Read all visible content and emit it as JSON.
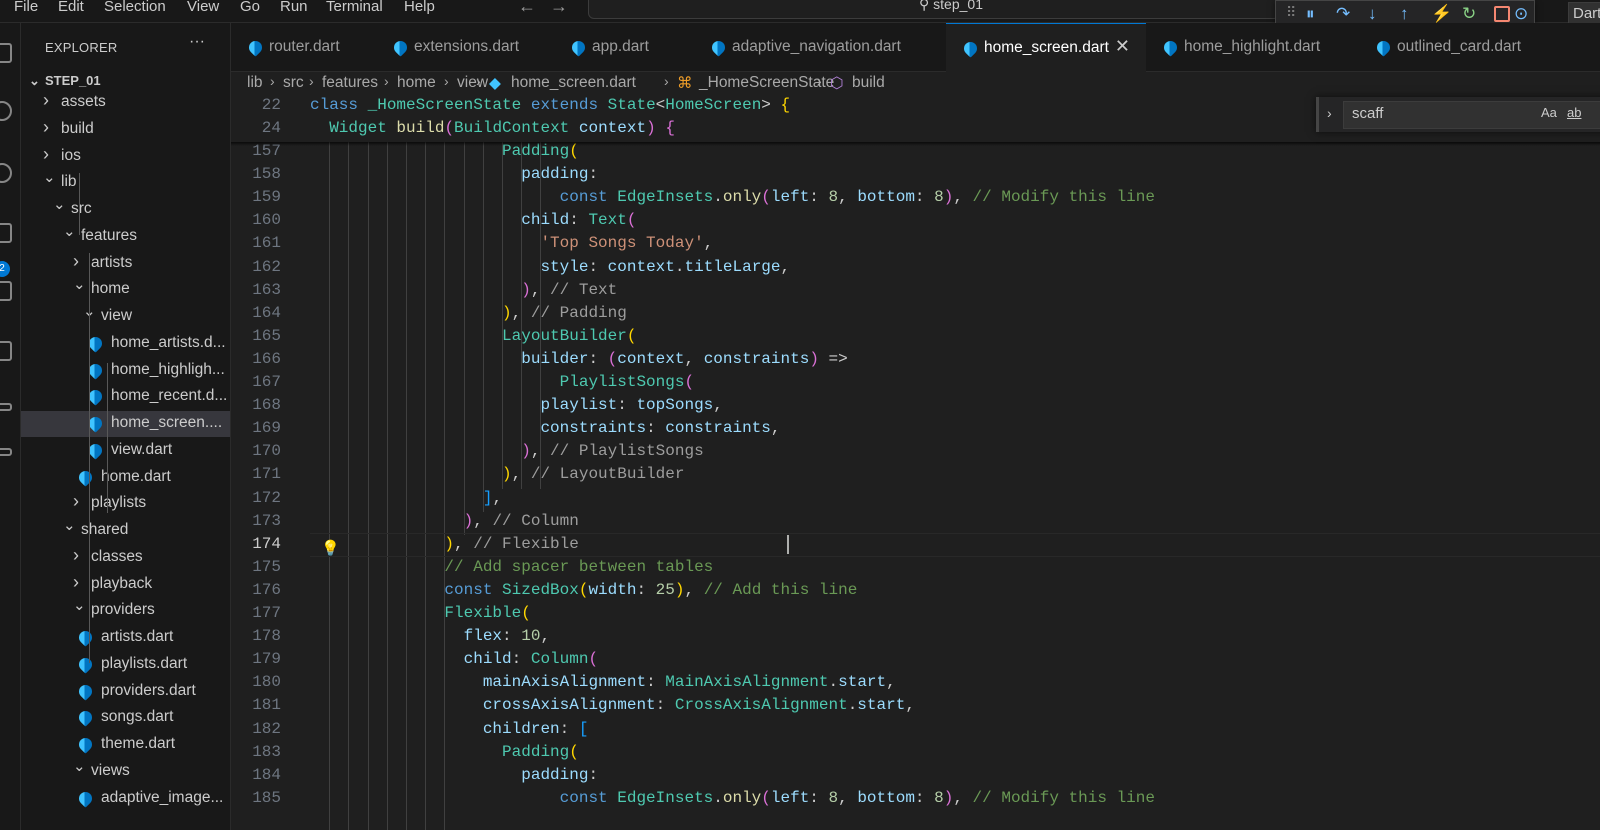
{
  "menu": [
    "File",
    "Edit",
    "Selection",
    "View",
    "Go",
    "Run",
    "Terminal",
    "Help"
  ],
  "command_center": {
    "text": "step_01"
  },
  "debug_toolbar": {
    "dart_label": "Dart"
  },
  "activity_badge": "2",
  "explorer": {
    "title": "EXPLORER",
    "more": "···",
    "root": "STEP_01",
    "items": [
      {
        "label": "assets",
        "type": "folder",
        "depth": 1,
        "open": false
      },
      {
        "label": "build",
        "type": "folder",
        "depth": 1,
        "open": false
      },
      {
        "label": "ios",
        "type": "folder",
        "depth": 1,
        "open": false
      },
      {
        "label": "lib",
        "type": "folder",
        "depth": 1,
        "open": true
      },
      {
        "label": "src",
        "type": "folder",
        "depth": 2,
        "open": true
      },
      {
        "label": "features",
        "type": "folder",
        "depth": 3,
        "open": true
      },
      {
        "label": "artists",
        "type": "folder",
        "depth": 4,
        "open": false
      },
      {
        "label": "home",
        "type": "folder",
        "depth": 4,
        "open": true
      },
      {
        "label": "view",
        "type": "folder",
        "depth": 5,
        "open": true
      },
      {
        "label": "home_artists.d...",
        "type": "file",
        "depth": 6
      },
      {
        "label": "home_highligh...",
        "type": "file",
        "depth": 6
      },
      {
        "label": "home_recent.d...",
        "type": "file",
        "depth": 6
      },
      {
        "label": "home_screen....",
        "type": "file",
        "depth": 6,
        "selected": true
      },
      {
        "label": "view.dart",
        "type": "file",
        "depth": 6
      },
      {
        "label": "home.dart",
        "type": "file",
        "depth": 5
      },
      {
        "label": "playlists",
        "type": "folder",
        "depth": 4,
        "open": false
      },
      {
        "label": "shared",
        "type": "folder",
        "depth": 3,
        "open": true
      },
      {
        "label": "classes",
        "type": "folder",
        "depth": 4,
        "open": false
      },
      {
        "label": "playback",
        "type": "folder",
        "depth": 4,
        "open": false
      },
      {
        "label": "providers",
        "type": "folder",
        "depth": 4,
        "open": true
      },
      {
        "label": "artists.dart",
        "type": "file",
        "depth": 5
      },
      {
        "label": "playlists.dart",
        "type": "file",
        "depth": 5
      },
      {
        "label": "providers.dart",
        "type": "file",
        "depth": 5
      },
      {
        "label": "songs.dart",
        "type": "file",
        "depth": 5
      },
      {
        "label": "theme.dart",
        "type": "file",
        "depth": 5
      },
      {
        "label": "views",
        "type": "folder",
        "depth": 4,
        "open": true
      },
      {
        "label": "adaptive_image...",
        "type": "file",
        "depth": 5
      }
    ]
  },
  "tabs": [
    {
      "label": "router.dart",
      "active": false
    },
    {
      "label": "extensions.dart",
      "active": false
    },
    {
      "label": "app.dart",
      "active": false
    },
    {
      "label": "adaptive_navigation.dart",
      "active": false
    },
    {
      "label": "home_screen.dart",
      "active": true
    },
    {
      "label": "home_highlight.dart",
      "active": false
    },
    {
      "label": "outlined_card.dart",
      "active": false
    }
  ],
  "breadcrumb": [
    "lib",
    "src",
    "features",
    "home",
    "view",
    "home_screen.dart",
    "_HomeScreenState",
    "build"
  ],
  "find": {
    "query": "scaff",
    "match_case": "Aa",
    "whole_word": "ab"
  },
  "editor": {
    "current_line": "174",
    "sticky_lines": [
      {
        "num": "22",
        "tokens": [
          [
            "kw",
            "class "
          ],
          [
            "ty",
            "_HomeScreenState "
          ],
          [
            "kw",
            "extends "
          ],
          [
            "ty",
            "State"
          ],
          [
            "pu",
            "<"
          ],
          [
            "ty",
            "HomeScreen"
          ],
          [
            "pu",
            "> "
          ],
          [
            "b1",
            "{"
          ]
        ]
      },
      {
        "num": "24",
        "tokens": [
          [
            "pu",
            "  "
          ],
          [
            "ty",
            "Widget "
          ],
          [
            "fn",
            "build"
          ],
          [
            "b2",
            "("
          ],
          [
            "ty",
            "BuildContext "
          ],
          [
            "prop",
            "context"
          ],
          [
            "b2",
            ")"
          ],
          [
            "pu",
            " "
          ],
          [
            "b2",
            "{"
          ]
        ]
      }
    ],
    "lines": [
      {
        "num": "157",
        "tokens": [
          [
            "pu",
            "                    "
          ],
          [
            "ty",
            "Padding"
          ],
          [
            "b1",
            "("
          ]
        ]
      },
      {
        "num": "158",
        "tokens": [
          [
            "pu",
            "                      "
          ],
          [
            "prop",
            "padding"
          ],
          [
            "pu",
            ":"
          ]
        ]
      },
      {
        "num": "159",
        "tokens": [
          [
            "pu",
            "                          "
          ],
          [
            "kw",
            "const "
          ],
          [
            "ty",
            "EdgeInsets"
          ],
          [
            "pu",
            "."
          ],
          [
            "fn",
            "only"
          ],
          [
            "b2",
            "("
          ],
          [
            "prop",
            "left"
          ],
          [
            "pu",
            ": "
          ],
          [
            "num",
            "8"
          ],
          [
            "pu",
            ", "
          ],
          [
            "prop",
            "bottom"
          ],
          [
            "pu",
            ": "
          ],
          [
            "num",
            "8"
          ],
          [
            "b2",
            ")"
          ],
          [
            "pu",
            ", "
          ],
          [
            "cm",
            "// Modify this line"
          ]
        ]
      },
      {
        "num": "160",
        "tokens": [
          [
            "pu",
            "                      "
          ],
          [
            "prop",
            "child"
          ],
          [
            "pu",
            ": "
          ],
          [
            "ty",
            "Text"
          ],
          [
            "b2",
            "("
          ]
        ]
      },
      {
        "num": "161",
        "tokens": [
          [
            "pu",
            "                        "
          ],
          [
            "str",
            "'Top Songs Today'"
          ],
          [
            "pu",
            ","
          ]
        ]
      },
      {
        "num": "162",
        "tokens": [
          [
            "pu",
            "                        "
          ],
          [
            "prop",
            "style"
          ],
          [
            "pu",
            ": "
          ],
          [
            "prop",
            "context"
          ],
          [
            "pu",
            "."
          ],
          [
            "prop",
            "titleLarge"
          ],
          [
            "pu",
            ","
          ]
        ]
      },
      {
        "num": "163",
        "tokens": [
          [
            "pu",
            "                      "
          ],
          [
            "b2",
            ")"
          ],
          [
            "pu",
            ", "
          ],
          [
            "cgray",
            "// Text"
          ]
        ]
      },
      {
        "num": "164",
        "tokens": [
          [
            "pu",
            "                    "
          ],
          [
            "b1",
            ")"
          ],
          [
            "pu",
            ", "
          ],
          [
            "cgray",
            "// Padding"
          ]
        ]
      },
      {
        "num": "165",
        "tokens": [
          [
            "pu",
            "                    "
          ],
          [
            "ty",
            "LayoutBuilder"
          ],
          [
            "b1",
            "("
          ]
        ]
      },
      {
        "num": "166",
        "tokens": [
          [
            "pu",
            "                      "
          ],
          [
            "prop",
            "builder"
          ],
          [
            "pu",
            ": "
          ],
          [
            "b2",
            "("
          ],
          [
            "prop",
            "context"
          ],
          [
            "pu",
            ", "
          ],
          [
            "prop",
            "constraints"
          ],
          [
            "b2",
            ")"
          ],
          [
            "pu",
            " =>"
          ]
        ]
      },
      {
        "num": "167",
        "tokens": [
          [
            "pu",
            "                          "
          ],
          [
            "ty",
            "PlaylistSongs"
          ],
          [
            "b2",
            "("
          ]
        ]
      },
      {
        "num": "168",
        "tokens": [
          [
            "pu",
            "                        "
          ],
          [
            "prop",
            "playlist"
          ],
          [
            "pu",
            ": "
          ],
          [
            "prop",
            "topSongs"
          ],
          [
            "pu",
            ","
          ]
        ]
      },
      {
        "num": "169",
        "tokens": [
          [
            "pu",
            "                        "
          ],
          [
            "prop",
            "constraints"
          ],
          [
            "pu",
            ": "
          ],
          [
            "prop",
            "constraints"
          ],
          [
            "pu",
            ","
          ]
        ]
      },
      {
        "num": "170",
        "tokens": [
          [
            "pu",
            "                      "
          ],
          [
            "b2",
            ")"
          ],
          [
            "pu",
            ", "
          ],
          [
            "cgray",
            "// PlaylistSongs"
          ]
        ]
      },
      {
        "num": "171",
        "tokens": [
          [
            "pu",
            "                    "
          ],
          [
            "b1",
            ")"
          ],
          [
            "pu",
            ", "
          ],
          [
            "cgray",
            "// LayoutBuilder"
          ]
        ]
      },
      {
        "num": "172",
        "tokens": [
          [
            "pu",
            "                  "
          ],
          [
            "b3",
            "]"
          ],
          [
            "pu",
            ","
          ]
        ]
      },
      {
        "num": "173",
        "tokens": [
          [
            "pu",
            "                "
          ],
          [
            "b2",
            ")"
          ],
          [
            "pu",
            ", "
          ],
          [
            "cgray",
            "// Column"
          ]
        ]
      },
      {
        "num": "174",
        "tokens": [
          [
            "pu",
            "              "
          ],
          [
            "b1",
            ")"
          ],
          [
            "pu",
            ", "
          ],
          [
            "cgray",
            "// Flexible"
          ]
        ]
      },
      {
        "num": "175",
        "tokens": [
          [
            "pu",
            "              "
          ],
          [
            "cm",
            "// Add spacer between tables"
          ]
        ]
      },
      {
        "num": "176",
        "tokens": [
          [
            "pu",
            "              "
          ],
          [
            "kw",
            "const "
          ],
          [
            "ty",
            "SizedBox"
          ],
          [
            "b1",
            "("
          ],
          [
            "prop",
            "width"
          ],
          [
            "pu",
            ": "
          ],
          [
            "num",
            "25"
          ],
          [
            "b1",
            ")"
          ],
          [
            "pu",
            ", "
          ],
          [
            "cm",
            "// Add this line"
          ]
        ]
      },
      {
        "num": "177",
        "tokens": [
          [
            "pu",
            "              "
          ],
          [
            "ty",
            "Flexible"
          ],
          [
            "b1",
            "("
          ]
        ]
      },
      {
        "num": "178",
        "tokens": [
          [
            "pu",
            "                "
          ],
          [
            "prop",
            "flex"
          ],
          [
            "pu",
            ": "
          ],
          [
            "num",
            "10"
          ],
          [
            "pu",
            ","
          ]
        ]
      },
      {
        "num": "179",
        "tokens": [
          [
            "pu",
            "                "
          ],
          [
            "prop",
            "child"
          ],
          [
            "pu",
            ": "
          ],
          [
            "ty",
            "Column"
          ],
          [
            "b2",
            "("
          ]
        ]
      },
      {
        "num": "180",
        "tokens": [
          [
            "pu",
            "                  "
          ],
          [
            "prop",
            "mainAxisAlignment"
          ],
          [
            "pu",
            ": "
          ],
          [
            "ty",
            "MainAxisAlignment"
          ],
          [
            "pu",
            "."
          ],
          [
            "prop",
            "start"
          ],
          [
            "pu",
            ","
          ]
        ]
      },
      {
        "num": "181",
        "tokens": [
          [
            "pu",
            "                  "
          ],
          [
            "prop",
            "crossAxisAlignment"
          ],
          [
            "pu",
            ": "
          ],
          [
            "ty",
            "CrossAxisAlignment"
          ],
          [
            "pu",
            "."
          ],
          [
            "prop",
            "start"
          ],
          [
            "pu",
            ","
          ]
        ]
      },
      {
        "num": "182",
        "tokens": [
          [
            "pu",
            "                  "
          ],
          [
            "prop",
            "children"
          ],
          [
            "pu",
            ": "
          ],
          [
            "b3",
            "["
          ]
        ]
      },
      {
        "num": "183",
        "tokens": [
          [
            "pu",
            "                    "
          ],
          [
            "ty",
            "Padding"
          ],
          [
            "b1",
            "("
          ]
        ]
      },
      {
        "num": "184",
        "tokens": [
          [
            "pu",
            "                      "
          ],
          [
            "prop",
            "padding"
          ],
          [
            "pu",
            ":"
          ]
        ]
      },
      {
        "num": "185",
        "tokens": [
          [
            "pu",
            "                          "
          ],
          [
            "kw",
            "const "
          ],
          [
            "ty",
            "EdgeInsets"
          ],
          [
            "pu",
            "."
          ],
          [
            "fn",
            "only"
          ],
          [
            "b2",
            "("
          ],
          [
            "prop",
            "left"
          ],
          [
            "pu",
            ": "
          ],
          [
            "num",
            "8"
          ],
          [
            "pu",
            ", "
          ],
          [
            "prop",
            "bottom"
          ],
          [
            "pu",
            ": "
          ],
          [
            "num",
            "8"
          ],
          [
            "b2",
            ")"
          ],
          [
            "pu",
            ", "
          ],
          [
            "cm",
            "// Modify this line"
          ]
        ]
      }
    ]
  }
}
